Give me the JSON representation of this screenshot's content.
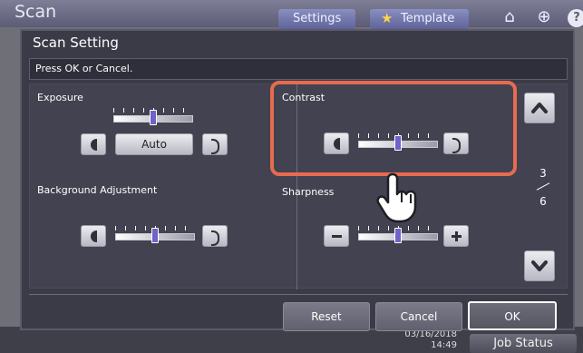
{
  "app": {
    "title": "Scan",
    "settings_label": "Settings",
    "template_label": "Template",
    "home_icon": "home-icon",
    "globe_icon": "globe-icon",
    "help_icon": "?",
    "footer_time": "03/16/2018\n14:49",
    "job_status_label": "Job Status"
  },
  "dialog": {
    "title": "Scan Setting",
    "message": "Press OK or Cancel.",
    "exposure": {
      "label": "Exposure",
      "auto_label": "Auto",
      "level": 0.5
    },
    "contrast": {
      "label": "Contrast",
      "level": 0.5
    },
    "background": {
      "label": "Background Adjustment",
      "level": 0.5
    },
    "sharpness": {
      "label": "Sharpness",
      "level": 0.5
    },
    "page": {
      "current": "3",
      "total": "6"
    },
    "buttons": {
      "reset": "Reset",
      "cancel": "Cancel",
      "ok": "OK"
    },
    "colors": {
      "highlight": "#e66b50",
      "knob": "#6f62c9"
    }
  }
}
